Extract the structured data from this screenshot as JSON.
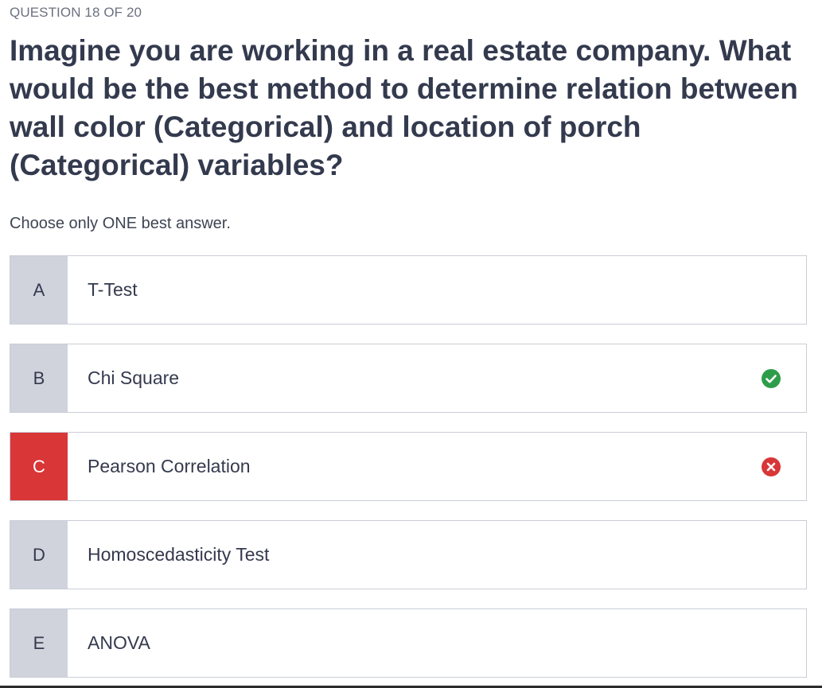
{
  "progress": "QUESTION 18 OF 20",
  "question": "Imagine you are working in a real estate company. What would be the best method to determine relation between wall color (Categorical) and location of porch (Categorical) variables?",
  "instruction": "Choose only ONE best answer.",
  "options": [
    {
      "letter": "A",
      "label": "T-Test",
      "state": "none"
    },
    {
      "letter": "B",
      "label": "Chi Square",
      "state": "correct",
      "icon": "check-circle-icon"
    },
    {
      "letter": "C",
      "label": "Pearson Correlation",
      "state": "wrong",
      "icon": "x-circle-icon"
    },
    {
      "letter": "D",
      "label": "Homoscedasticity Test",
      "state": "none"
    },
    {
      "letter": "E",
      "label": "ANOVA",
      "state": "none"
    }
  ],
  "colors": {
    "correct": "#2e9d4a",
    "wrong": "#d93637",
    "letter_bg": "#d0d3dc",
    "text": "#343a4e"
  }
}
